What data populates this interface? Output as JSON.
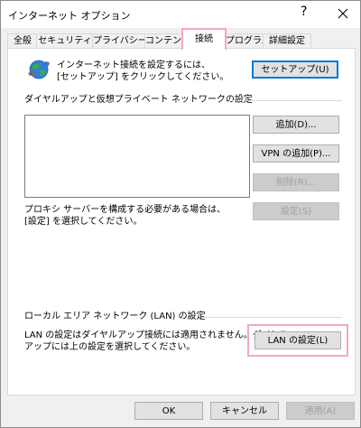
{
  "window": {
    "title": "インターネット オプション",
    "help_glyph": "?"
  },
  "tabs": [
    {
      "label": "全般"
    },
    {
      "label": "セキュリティ"
    },
    {
      "label": "プライバシー"
    },
    {
      "label": "コンテンツ"
    },
    {
      "label": "接続"
    },
    {
      "label": "プログラム"
    },
    {
      "label": "詳細設定"
    }
  ],
  "active_tab_index": 4,
  "setup": {
    "line1": "インターネット接続を設定するには、",
    "line2": "[セットアップ] をクリックしてください。",
    "button": "セットアップ(U)"
  },
  "dialup": {
    "heading": "ダイヤルアップと仮想プライベート ネットワークの設定",
    "items": [],
    "add_button": "追加(D)...",
    "add_vpn_button": "VPN の追加(P)...",
    "delete_button": "削除(R)...",
    "settings_button": "設定(S)",
    "proxy_line1": "プロキシ サーバーを構成する必要がある場合は、",
    "proxy_line2": "[設定] を選択してください。"
  },
  "lan": {
    "heading": "ローカル エリア ネットワーク (LAN) の設定",
    "line1": "LAN の設定はダイヤルアップ接続には適用されません。ダイヤル",
    "line2": "アップには上の設定を選択してください。",
    "button": "LAN の設定(L)"
  },
  "footer": {
    "ok": "OK",
    "cancel": "キャンセル",
    "apply": "適用(A)"
  },
  "colors": {
    "highlight": "#f5a7c6",
    "focus": "#0078d7"
  }
}
